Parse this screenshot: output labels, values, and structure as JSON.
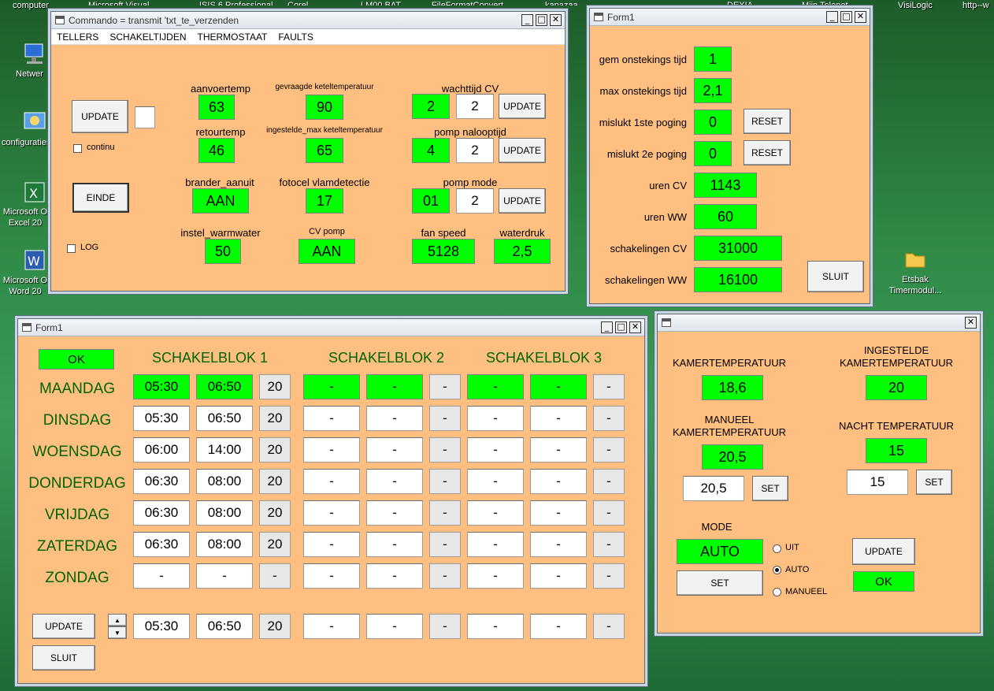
{
  "desktop": {
    "icons": [
      {
        "label": "computer"
      },
      {
        "label": "Netwer"
      },
      {
        "label": "configuraties"
      },
      {
        "label": "Microsoft O Excel 20"
      },
      {
        "label": "Microsoft O Word 20"
      },
      {
        "label": "Etsbak Timermodul..."
      },
      {
        "label": "VisiLogic"
      },
      {
        "label": "http--w"
      }
    ],
    "top_labels": [
      "Microsoft Visual",
      "ISIS 6 Professional",
      "Corel",
      "LM00.BAT",
      "FileFormatConvert",
      "kanazaa",
      "DEXIA",
      "Mijn Telenet"
    ]
  },
  "win1": {
    "title": "Commando = transmit 'txt_te_verzenden",
    "menu": [
      "TELLERS",
      "SCHAKELTIJDEN",
      "THERMOSTAAT",
      "FAULTS"
    ],
    "update_label": "UPDATE",
    "continu_label": "continu",
    "einde_label": "EINDE",
    "log_label": "LOG",
    "aanvoertemp": {
      "label": "aanvoertemp",
      "value": "63"
    },
    "retourtemp": {
      "label": "retourtemp",
      "value": "46"
    },
    "brander": {
      "label": "brander_aanuit",
      "value": "AAN"
    },
    "warmwater": {
      "label": "instel_warmwater",
      "value": "50"
    },
    "gevraagde": {
      "label": "gevraagde keteltemperatuur",
      "value": "90"
    },
    "ingestelde": {
      "label": "ingestelde_max keteltemperatuur",
      "value": "65"
    },
    "fotocel": {
      "label": "fotocel vlamdetectie",
      "value": "17"
    },
    "cvpomp": {
      "label": "CV pomp",
      "value": "AAN"
    },
    "wachttijd": {
      "label": "wachttijd CV",
      "value": "2",
      "input": "2",
      "button": "UPDATE"
    },
    "pomp_naloop": {
      "label": "pomp nalooptijd",
      "value": "4",
      "input": "2",
      "button": "UPDATE"
    },
    "pomp_mode": {
      "label": "pomp mode",
      "value": "01",
      "input": "2",
      "button": "UPDATE"
    },
    "fan_speed": {
      "label": "fan speed",
      "value": "5128"
    },
    "waterdruk": {
      "label": "waterdruk",
      "value": "2,5"
    }
  },
  "win2": {
    "title": "Form1",
    "rows": [
      {
        "label": "gem onstekings tijd",
        "value": "1"
      },
      {
        "label": "max onstekings tijd",
        "value": "2,1"
      },
      {
        "label": "mislukt 1ste poging",
        "value": "0",
        "button": "RESET"
      },
      {
        "label": "mislukt 2e poging",
        "value": "0",
        "button": "RESET"
      },
      {
        "label": "uren CV",
        "value": "1143"
      },
      {
        "label": "uren WW",
        "value": "60"
      },
      {
        "label": "schakelingen CV",
        "value": "31000"
      },
      {
        "label": "schakelingen WW",
        "value": "16100"
      }
    ],
    "sluit_label": "SLUIT"
  },
  "win3": {
    "title": "Form1",
    "ok_label": "OK",
    "headers": [
      "SCHAKELBLOK 1",
      "SCHAKELBLOK 2",
      "SCHAKELBLOK 3"
    ],
    "days": [
      {
        "name": "MAANDAG",
        "vals": [
          "05:30",
          "06:50",
          "20",
          "-",
          "-",
          "-",
          "-",
          "-",
          "-"
        ]
      },
      {
        "name": "DINSDAG",
        "vals": [
          "05:30",
          "06:50",
          "20",
          "-",
          "-",
          "-",
          "-",
          "-",
          "-"
        ]
      },
      {
        "name": "WOENSDAG",
        "vals": [
          "06:00",
          "14:00",
          "20",
          "-",
          "-",
          "-",
          "-",
          "-",
          "-"
        ]
      },
      {
        "name": "DONDERDAG",
        "vals": [
          "06:30",
          "08:00",
          "20",
          "-",
          "-",
          "-",
          "-",
          "-",
          "-"
        ]
      },
      {
        "name": "VRIJDAG",
        "vals": [
          "06:30",
          "08:00",
          "20",
          "-",
          "-",
          "-",
          "-",
          "-",
          "-"
        ]
      },
      {
        "name": "ZATERDAG",
        "vals": [
          "06:30",
          "08:00",
          "20",
          "-",
          "-",
          "-",
          "-",
          "-",
          "-"
        ]
      },
      {
        "name": "ZONDAG",
        "vals": [
          "-",
          "-",
          "-",
          "-",
          "-",
          "-",
          "-",
          "-",
          "-"
        ]
      }
    ],
    "edit_vals": [
      "05:30",
      "06:50",
      "20",
      "-",
      "-",
      "-",
      "-",
      "-",
      "-"
    ],
    "update_label": "UPDATE",
    "sluit_label": "SLUIT"
  },
  "win4": {
    "kamertemp": {
      "label": "KAMERTEMPERATUUR",
      "value": "18,6"
    },
    "ingestelde": {
      "label1": "INGESTELDE",
      "label2": "KAMERTEMPERATUUR",
      "value": "20"
    },
    "manueel": {
      "label1": "MANUEEL",
      "label2": "KAMERTEMPERATUUR",
      "value": "20,5",
      "input": "20,5",
      "button": "SET"
    },
    "nacht": {
      "label": "NACHT TEMPERATUUR",
      "value": "15",
      "input": "15",
      "button": "SET"
    },
    "mode": {
      "label": "MODE",
      "value": "AUTO",
      "button": "SET"
    },
    "radios": [
      {
        "label": "UIT",
        "checked": false
      },
      {
        "label": "AUTO",
        "checked": true
      },
      {
        "label": "MANUEEL",
        "checked": false
      }
    ],
    "update_label": "UPDATE",
    "ok_label": "OK"
  }
}
